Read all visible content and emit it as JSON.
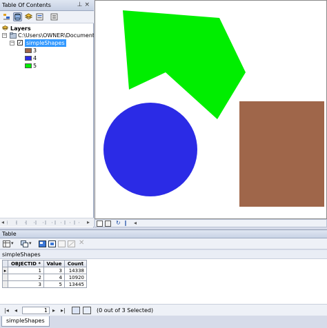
{
  "toc": {
    "title": "Table Of Contents",
    "title_controls": "⨯ ×",
    "tree": {
      "layers_label": "Layers",
      "workspace_path": "C:\\Users\\OWNER\\Documents\\A",
      "layer_name": "simpleShapes",
      "legend": [
        {
          "label": "3",
          "color": "#9f664a"
        },
        {
          "label": "4",
          "color": "#2b2be6"
        },
        {
          "label": "5",
          "color": "#00ee00"
        }
      ]
    }
  },
  "map": {
    "background": "#ffffff"
  },
  "table_window": {
    "title": "Table",
    "active_table": "simpleShapes",
    "columns": [
      "OBJECTID *",
      "Value",
      "Count"
    ],
    "rows": [
      [
        "1",
        "3",
        "14338"
      ],
      [
        "2",
        "4",
        "10920"
      ],
      [
        "3",
        "5",
        "13445"
      ]
    ],
    "current_record": "1",
    "selection_status": "(0 out of 3 Selected)",
    "bottom_tab": "simpleShapes"
  },
  "colors": {
    "brown_shape": "#9f664a",
    "blue_shape": "#2b2be6",
    "green_shape": "#00ee00",
    "selection": "#3399ff"
  }
}
